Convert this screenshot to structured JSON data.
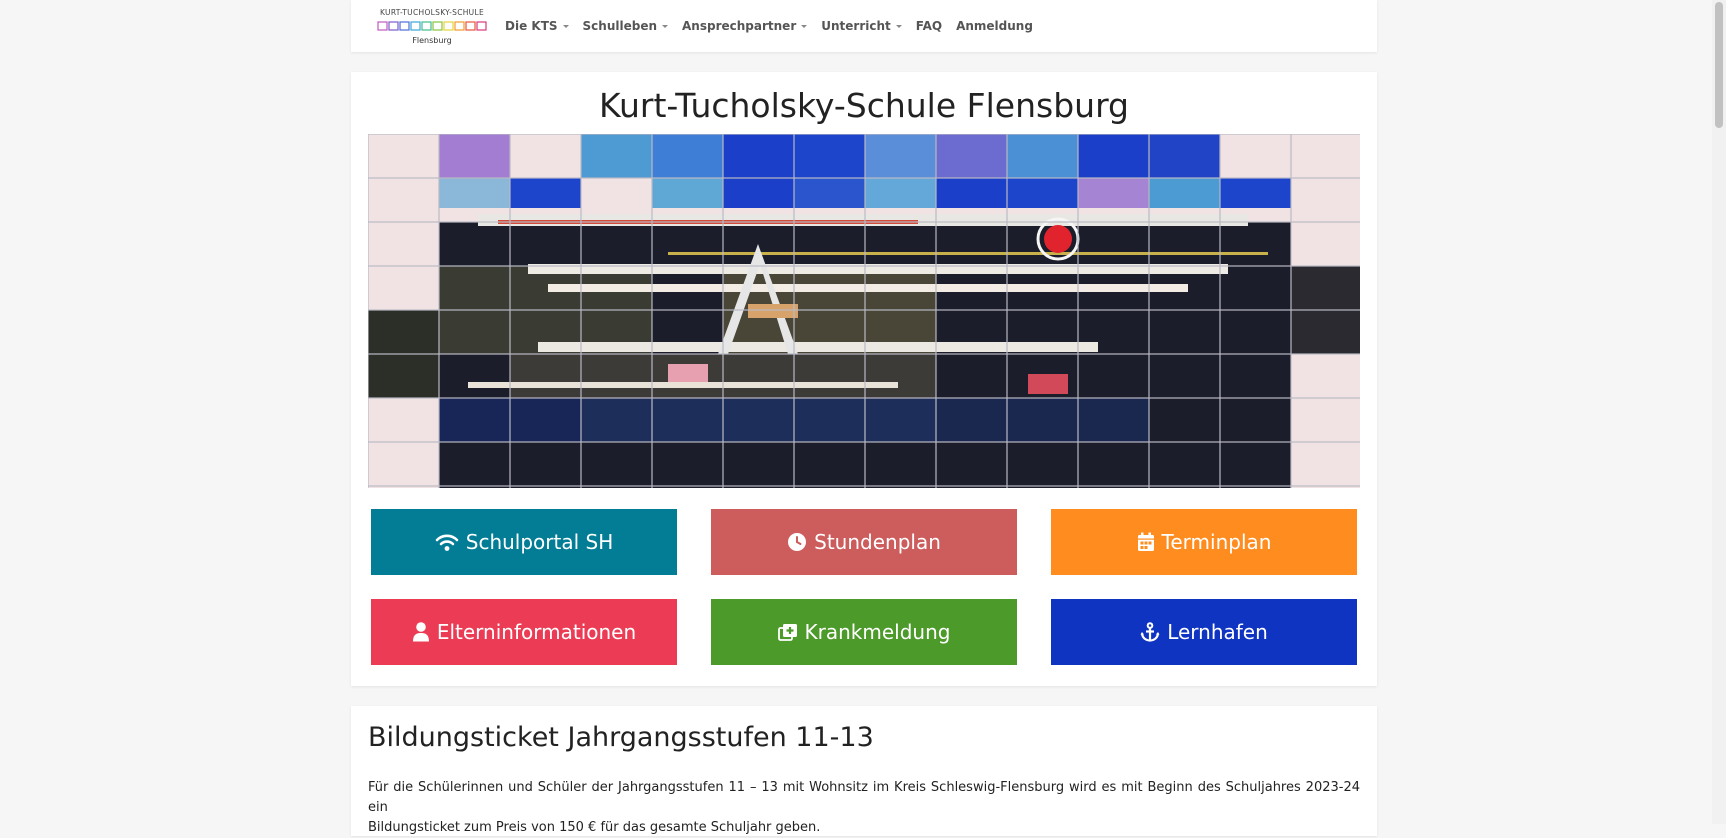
{
  "logo": {
    "line1": "KURT-TUCHOLSKY-SCHULE",
    "line2": "Flensburg"
  },
  "nav": {
    "items": [
      {
        "label": "Die KTS",
        "dropdown": true
      },
      {
        "label": "Schulleben",
        "dropdown": true
      },
      {
        "label": "Ansprechpartner",
        "dropdown": true
      },
      {
        "label": "Unterricht",
        "dropdown": true
      },
      {
        "label": "FAQ",
        "dropdown": false
      },
      {
        "label": "Anmeldung",
        "dropdown": false
      }
    ]
  },
  "hero": {
    "title": "Kurt-Tucholsky-Schule Flensburg",
    "buttons": [
      {
        "label": "Schulportal SH",
        "icon": "wifi-icon",
        "color": "#037d96"
      },
      {
        "label": "Stundenplan",
        "icon": "clock-icon",
        "color": "#cd5c5c"
      },
      {
        "label": "Terminplan",
        "icon": "calendar-icon",
        "color": "#ff8c1f"
      },
      {
        "label": "Elterninformationen",
        "icon": "user-icon",
        "color": "#ec3c55"
      },
      {
        "label": "Krankmeldung",
        "icon": "medical-plus-icon",
        "color": "#4c9a2a"
      },
      {
        "label": "Lernhafen",
        "icon": "anchor-icon",
        "color": "#0f34c2"
      }
    ]
  },
  "article": {
    "title": "Bildungsticket Jahrgangsstufen 11-13",
    "text_line1": "Für die Schülerinnen und Schüler der Jahrgangsstufen 11 – 13 mit Wohnsitz im Kreis Schleswig-Flensburg wird es mit Beginn des Schuljahres 2023-24 ein",
    "text_line2": "Bildungsticket zum Preis von 150 € für das gesamte Schuljahr geben."
  }
}
